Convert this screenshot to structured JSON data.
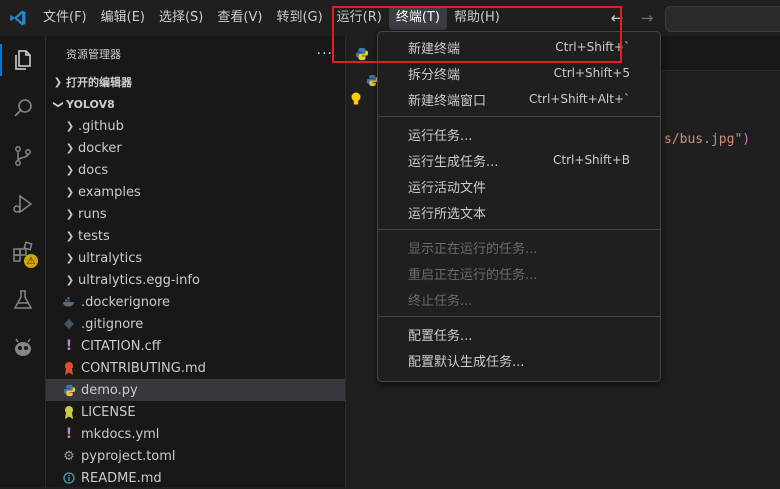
{
  "menubar": {
    "items": [
      "文件(F)",
      "编辑(E)",
      "选择(S)",
      "查看(V)",
      "转到(G)",
      "运行(R)",
      "终端(T)",
      "帮助(H)"
    ],
    "active_index": 6
  },
  "sidebar": {
    "title": "资源管理器",
    "more": "···",
    "open_editors": "打开的编辑器",
    "project": "YOLOV8",
    "items": [
      {
        "label": ".github",
        "type": "folder"
      },
      {
        "label": "docker",
        "type": "folder"
      },
      {
        "label": "docs",
        "type": "folder"
      },
      {
        "label": "examples",
        "type": "folder"
      },
      {
        "label": "runs",
        "type": "folder"
      },
      {
        "label": "tests",
        "type": "folder"
      },
      {
        "label": "ultralytics",
        "type": "folder"
      },
      {
        "label": "ultralytics.egg-info",
        "type": "folder"
      },
      {
        "label": ".dockerignore",
        "type": "docker"
      },
      {
        "label": ".gitignore",
        "type": "git"
      },
      {
        "label": "CITATION.cff",
        "type": "exclaim"
      },
      {
        "label": "CONTRIBUTING.md",
        "type": "ribbon"
      },
      {
        "label": "demo.py",
        "type": "python",
        "selected": true
      },
      {
        "label": "LICENSE",
        "type": "license"
      },
      {
        "label": "mkdocs.yml",
        "type": "exclaim"
      },
      {
        "label": "pyproject.toml",
        "type": "gear"
      },
      {
        "label": "README.md",
        "type": "info"
      }
    ]
  },
  "editor": {
    "code_fragment": "s/bus.jpg\"",
    "code_paren": ")"
  },
  "terminal_menu": {
    "groups": [
      [
        {
          "label": "新建终端",
          "shortcut": "Ctrl+Shift+`",
          "disabled": false
        },
        {
          "label": "拆分终端",
          "shortcut": "Ctrl+Shift+5",
          "disabled": false
        },
        {
          "label": "新建终端窗口",
          "shortcut": "Ctrl+Shift+Alt+`",
          "disabled": false
        }
      ],
      [
        {
          "label": "运行任务...",
          "shortcut": "",
          "disabled": false
        },
        {
          "label": "运行生成任务...",
          "shortcut": "Ctrl+Shift+B",
          "disabled": false
        },
        {
          "label": "运行活动文件",
          "shortcut": "",
          "disabled": false
        },
        {
          "label": "运行所选文本",
          "shortcut": "",
          "disabled": false
        }
      ],
      [
        {
          "label": "显示正在运行的任务...",
          "shortcut": "",
          "disabled": true
        },
        {
          "label": "重启正在运行的任务...",
          "shortcut": "",
          "disabled": true
        },
        {
          "label": "终止任务...",
          "shortcut": "",
          "disabled": true
        }
      ],
      [
        {
          "label": "配置任务...",
          "shortcut": "",
          "disabled": false
        },
        {
          "label": "配置默认生成任务...",
          "shortcut": "",
          "disabled": false
        }
      ]
    ]
  },
  "colors": {
    "accent": "#0078d4",
    "highlight_box": "#e51c23",
    "warning": "#cca700"
  }
}
